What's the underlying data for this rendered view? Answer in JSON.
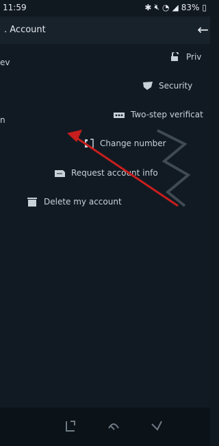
{
  "status_bar": {
    "time": "11:59",
    "battery_percent": "83%"
  },
  "header": {
    "title": ". Account",
    "back_icon": "back-arrow-icon"
  },
  "edge_fragments": {
    "left_1": "ev",
    "left_2": "n"
  },
  "settings": [
    {
      "label": "Priv",
      "icon": "lock-icon"
    },
    {
      "label": "Security",
      "icon": "shield-icon"
    },
    {
      "label": "Two-step verificat",
      "icon": "dots-icon"
    },
    {
      "label": "Change number",
      "icon": "phone-icon"
    },
    {
      "label": "Request account info",
      "icon": "document-icon"
    },
    {
      "label": "Delete my account",
      "icon": "trash-icon"
    }
  ],
  "colors": {
    "background": "#101820",
    "appbar": "#18222b",
    "arrow": "#c81e1e",
    "text": "#c9d1d8"
  }
}
